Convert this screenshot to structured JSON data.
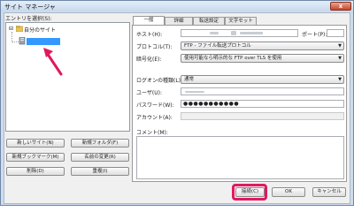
{
  "window": {
    "title": "サイト マネージャ",
    "close_label": "x"
  },
  "left": {
    "entry_label": "エントリを選択(S):",
    "tree_root": "自分のサイト",
    "buttons": {
      "new_site": "新しいサイト(N)",
      "new_folder": "新規フォルダ(F)",
      "new_bookmark": "新規ブックマーク(M)",
      "rename": "名前の変更(R)",
      "delete": "削除(D)",
      "duplicate": "重複(I)"
    }
  },
  "tabs": [
    "一般",
    "詳細",
    "転送設定",
    "文字セット"
  ],
  "general": {
    "host_label": "ホスト(H):",
    "port_label": "ポート(P):",
    "protocol_label": "プロトコル(T):",
    "protocol_value": "FTP - ファイル転送プロトコル",
    "encryption_label": "暗号化(E):",
    "encryption_value": "使用可能なら明示的な FTP over TLS を使用",
    "logon_label": "ログオンの種類(L):",
    "logon_value": "通常",
    "user_label": "ユーザ(U):",
    "password_label": "パスワード(W):",
    "password_value": "●●●●●●●●●●●",
    "account_label": "アカウント(A):",
    "comment_label": "コメント(M):"
  },
  "footer": {
    "connect": "接続(C)",
    "ok": "OK",
    "cancel": "キャンセル"
  },
  "colors": {
    "highlight": "#e0195f",
    "arrow": "#e0195f",
    "selection": "#3399ff"
  }
}
